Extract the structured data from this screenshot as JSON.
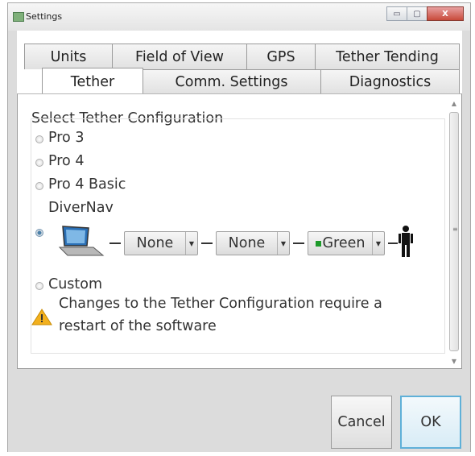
{
  "window": {
    "title": "Settings",
    "controls": {
      "minimize": "▭",
      "maximize": "▢",
      "close": "X"
    }
  },
  "tabs": {
    "row1": [
      "Units",
      "Field of View",
      "GPS",
      "Tether Tending"
    ],
    "row2": [
      "Tether",
      "Comm. Settings",
      "Diagnostics"
    ],
    "active": "Tether"
  },
  "tether": {
    "group_title": "Select Tether Configuration",
    "options": [
      "Pro 3",
      "Pro 4",
      "Pro 4 Basic"
    ],
    "divernav_label": "DiverNav",
    "selected": "DiverNav",
    "chain": {
      "combo1": "None",
      "combo2": "None",
      "combo3": "Green",
      "combo3_color": "#1d9a2a"
    },
    "custom_label": "Custom",
    "warning_line1": "Changes to the Tether Configuration require a",
    "warning_line2": "restart of the software"
  },
  "scrollbar": {
    "up_arrow": "▲",
    "down_arrow": "▼",
    "grip": "≡"
  },
  "buttons": {
    "cancel": "Cancel",
    "ok": "OK"
  },
  "icons": [
    "laptop-icon",
    "person-icon",
    "warning-icon",
    "chevron-down-icon"
  ]
}
